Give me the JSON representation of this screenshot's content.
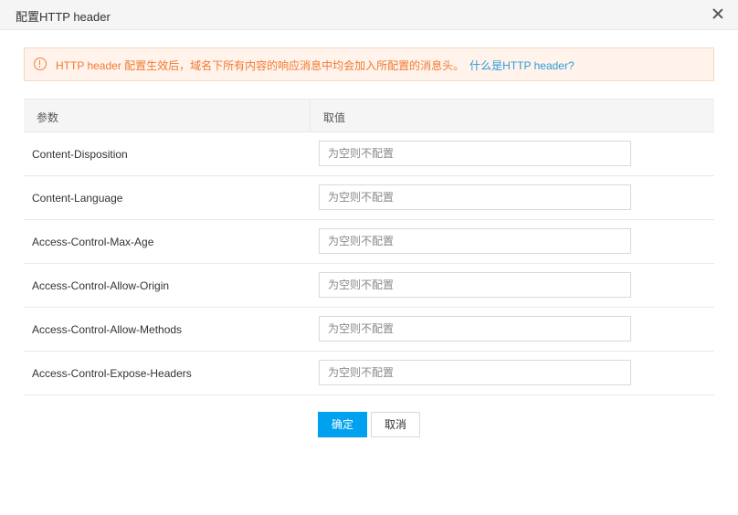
{
  "dialog": {
    "title": "配置HTTP header",
    "close_icon": "close-icon"
  },
  "alert": {
    "icon": "warning-circle-icon",
    "message": "HTTP header 配置生效后，域名下所有内容的响应消息中均会加入所配置的消息头。",
    "link": "什么是HTTP header?",
    "color": "#f07a30",
    "link_color": "#2b9cd8"
  },
  "table": {
    "headers": [
      "参数",
      "取值"
    ],
    "rows": [
      {
        "name": "Content-Disposition",
        "value": "",
        "placeholder": "为空则不配置"
      },
      {
        "name": "Content-Language",
        "value": "",
        "placeholder": "为空则不配置"
      },
      {
        "name": "Access-Control-Max-Age",
        "value": "",
        "placeholder": "为空则不配置"
      },
      {
        "name": "Access-Control-Allow-Origin",
        "value": "",
        "placeholder": "为空则不配置"
      },
      {
        "name": "Access-Control-Allow-Methods",
        "value": "",
        "placeholder": "为空则不配置"
      },
      {
        "name": "Access-Control-Expose-Headers",
        "value": "",
        "placeholder": "为空则不配置"
      }
    ]
  },
  "footer": {
    "ok_label": "确定",
    "cancel_label": "取消",
    "accent": "#00a2f0"
  }
}
